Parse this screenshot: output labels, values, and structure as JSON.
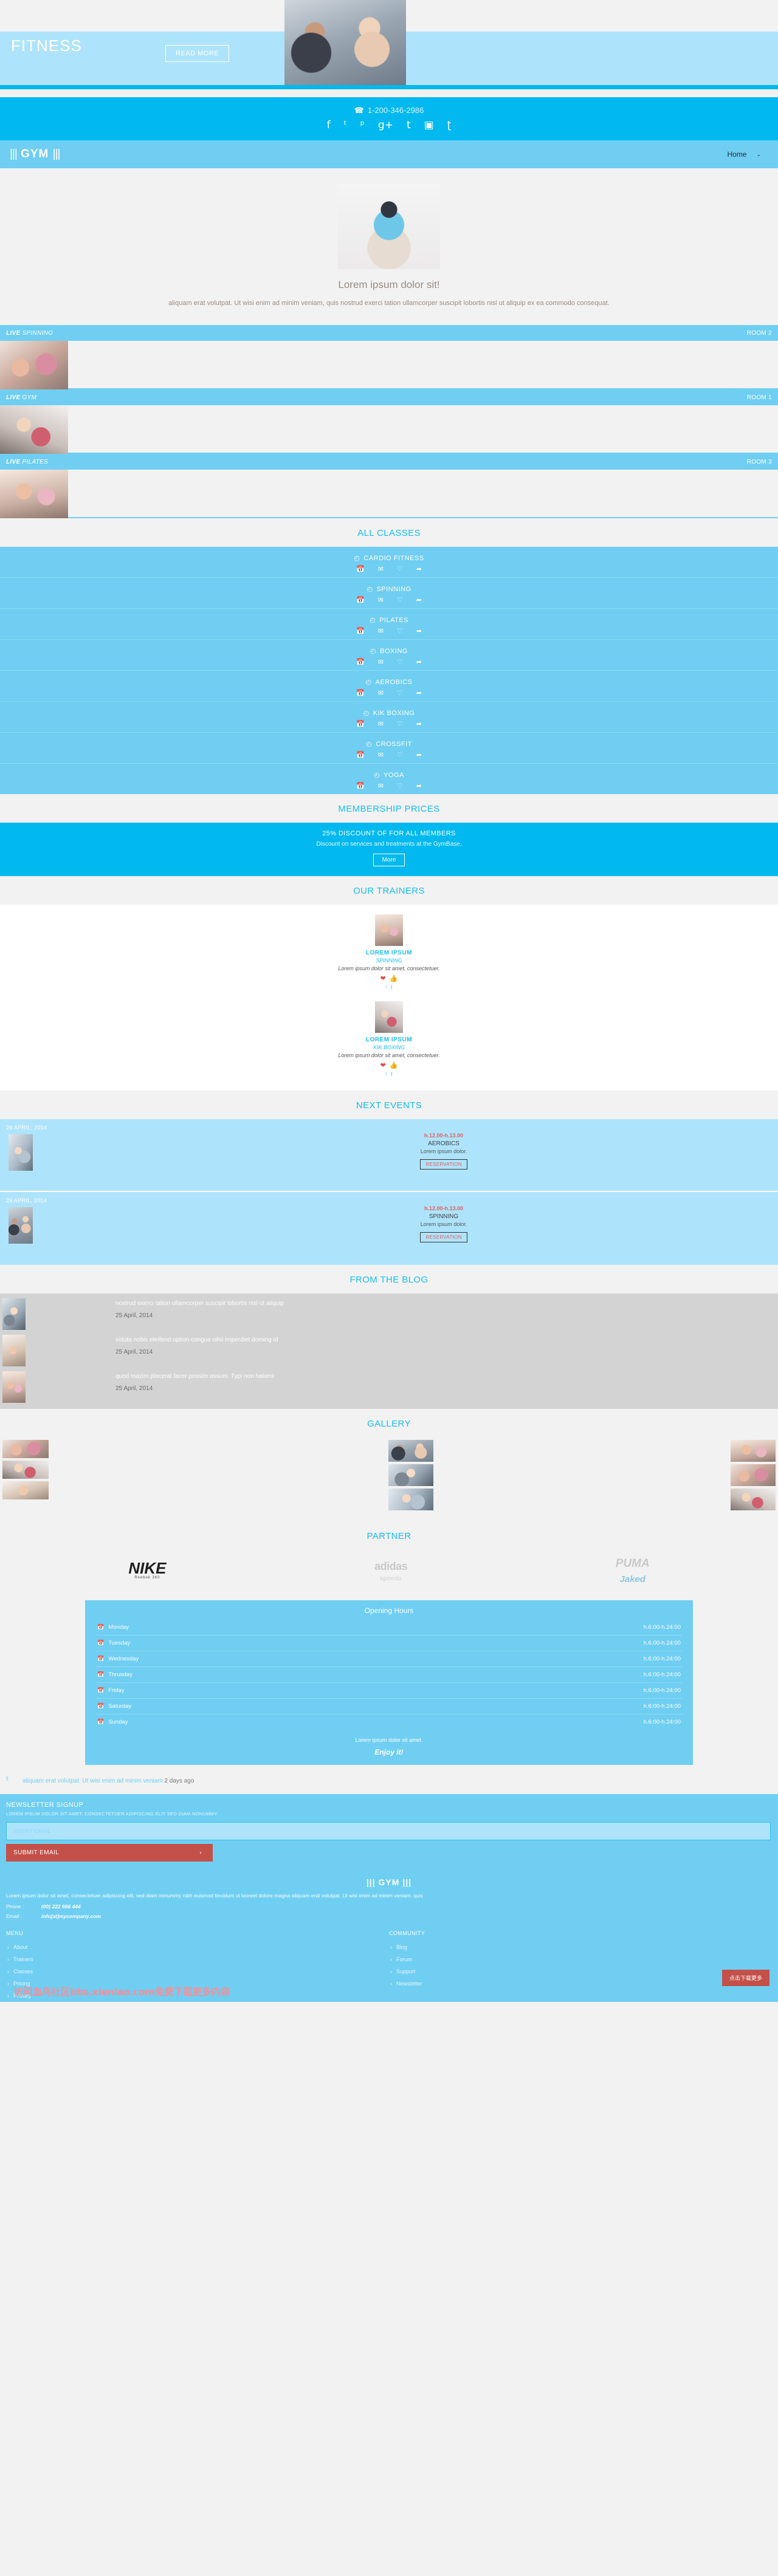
{
  "slider": {
    "title": "FITNESS",
    "read_more": "READ MORE"
  },
  "contact_bar": {
    "phone_icon": "phone-icon",
    "phone": "1-200-346-2986",
    "social": [
      {
        "name": "facebook-icon",
        "glyph": "f"
      },
      {
        "name": "twitter-icon",
        "glyph": "ᵗ"
      },
      {
        "name": "pinterest-icon",
        "glyph": "ᵖ"
      },
      {
        "name": "google-plus-icon",
        "glyph": "g+"
      },
      {
        "name": "tumblr-icon",
        "glyph": "t"
      },
      {
        "name": "instagram-icon",
        "glyph": "▣"
      },
      {
        "name": "rss-icon",
        "glyph": "ʈ"
      }
    ]
  },
  "nav": {
    "logo_left_bars": "|||",
    "logo_text": "GYM",
    "logo_right_bars": "|||",
    "menu": [
      {
        "label": "Home",
        "has_caret": true
      }
    ],
    "caret": "⌄"
  },
  "hero": {
    "title": "Lorem ipsum dolor sit!",
    "desc": "aliquam erat volutpat. Ut wisi enim ad minim veniam, quis nostrud exerci tation ullamcorper suscipit lobortis nisl ut aliquip ex ea commodo consequat."
  },
  "live": [
    {
      "prefix": "LIVE",
      "name": "SPINNING",
      "room": "ROOM 2",
      "thumb": "gymB"
    },
    {
      "prefix": "LIVE",
      "name": "GYM",
      "room": "ROOM 1",
      "thumb": "gymD"
    },
    {
      "prefix": "LIVE",
      "name": "PILATES",
      "room": "ROOM 3",
      "thumb": "gymG"
    }
  ],
  "classes": {
    "title": "ALL CLASSES",
    "icons": [
      {
        "name": "calendar-icon",
        "glyph": "📅"
      },
      {
        "name": "mail-icon",
        "glyph": "✉"
      },
      {
        "name": "heart-icon",
        "glyph": "♡"
      },
      {
        "name": "share-icon",
        "glyph": "➦"
      }
    ],
    "clock_glyph": "◴",
    "items": [
      {
        "name": "CARDIO FITNESS"
      },
      {
        "name": "SPINNING"
      },
      {
        "name": "PILATES"
      },
      {
        "name": "BOXING"
      },
      {
        "name": "AEROBICS"
      },
      {
        "name": "KIK BOXING"
      },
      {
        "name": "CROSSFIT"
      },
      {
        "name": "YOGA"
      }
    ]
  },
  "membership": {
    "title": "MEMBERSHIP PRICES",
    "headline": "25% DISCOUNT OF FOR ALL MEMBERS",
    "sub": "Discount on services and treatments at the GymBase.",
    "button": "More"
  },
  "trainers": {
    "title": "OUR TRAINERS",
    "items": [
      {
        "name": "LOREM IPSUM",
        "role": "SPINNING",
        "bio": "Lorem ipsum dolor sit amet, consectetuer.",
        "photo": "trainerA"
      },
      {
        "name": "LOREM IPSUM",
        "role": "KIK BOXING",
        "bio": "Lorem ipsum dolor sit amet, consectetuer.",
        "photo": "trainerB"
      }
    ],
    "heart_glyph": "❤",
    "thumb_glyph": "👍",
    "twitter_glyph": "ᵗ",
    "facebook_glyph": "f"
  },
  "events": {
    "title": "NEXT EVENTS",
    "items": [
      {
        "date": "26 APRIL, 2014",
        "time": "h.12.00-h.13.00",
        "name": "AEROBICS",
        "desc": "Lorem ipsum dolor.",
        "button": "RESERVATION",
        "thumb": "gymC"
      },
      {
        "date": "26 APRIL, 2014",
        "time": "h.12.00-h.13.00",
        "name": "SPINNING",
        "desc": "Lorem ipsum dolor.",
        "button": "RESERVATION",
        "thumb": "gymA"
      }
    ]
  },
  "blog": {
    "title": "FROM THE BLOG",
    "items": [
      {
        "title": "nostrud exerci tation ullamcorper suscipit lobortis nisl ut aliquip",
        "date": "25 April, 2014",
        "thumb": "gymE"
      },
      {
        "title": "soluta nobis eleifend option congue nihil imperdiet doming id",
        "date": "25 April, 2014",
        "thumb": "gymF"
      },
      {
        "title": "quod mazim placerat facer possim assum. Typi non habent",
        "date": "25 April, 2014",
        "thumb": "gymG"
      }
    ]
  },
  "gallery": {
    "title": "GALLERY"
  },
  "partner": {
    "title": "PARTNER",
    "brands": [
      {
        "name": "NIKE",
        "sub": "Reebok 360"
      },
      {
        "name": "adidas",
        "sub": "speedo"
      },
      {
        "name": "PUMA",
        "sub": "Jaked"
      }
    ]
  },
  "hours": {
    "title": "Opening Hours",
    "calendar_glyph": "📅",
    "rows": [
      {
        "day": "Monday",
        "time": "h.6:00-h.24:00"
      },
      {
        "day": "Tuesday",
        "time": "h.6:00-h.24:00"
      },
      {
        "day": "Wednesday",
        "time": "h.6:00-h.24:00"
      },
      {
        "day": "Thrusday",
        "time": "h.6:00-h.24:00"
      },
      {
        "day": "Friday",
        "time": "h.6:00-h.24:00"
      },
      {
        "day": "Saturday",
        "time": "h.6:00-h.24:00"
      },
      {
        "day": "Sunday",
        "time": "h.6:00-h.24:00"
      }
    ],
    "note": "Lorem ipsum dolor sit amet.",
    "enjoy": "Enjoy it!"
  },
  "tweet": {
    "icon": "twitter-icon",
    "text": "aliquam erat volutpat. Ut wisi enim ad minim veniam",
    "ago": "2 days ago"
  },
  "newsletter": {
    "title": "NEWSLETTER SIGNUP",
    "sub": "LOREM IPSUM DOLOR SIT AMET, CONSECTETUER ADIPISCING ELIT SED DIAM NONUMMY.",
    "input_placeholder": "INSERT EMAIL",
    "input_value": "",
    "submit": "SUBMIT EMAIL",
    "submit_arrow": "›"
  },
  "footer": {
    "logo_left_bars": "|||",
    "logo_text": "GYM",
    "logo_right_bars": "|||",
    "about": "Lorem ipsum dolor sit amet, consectetuer adipiscing elit, sed diam nonummy nibh euismod tincidunt ut laoreet dolore magna aliquam erat volutpat. Ut wisi enim ad minim veniam, quis",
    "phone_label": "Phone :",
    "phone_value": "(00) 222 666 444",
    "email_label": "Email :",
    "email_value": "info[at]mycompany.com",
    "menu_title": "MENU",
    "menu_links": [
      "About",
      "Trainers",
      "Classes",
      "Pricing",
      "Privacy"
    ],
    "community_title": "COMMUNITY",
    "community_links": [
      "Blog",
      "Forum",
      "Support",
      "Newsletter"
    ],
    "watermark": "访问血鸟社区bbs.xienlao.com免费下载更多内容",
    "download_button": "点击下载更多"
  }
}
